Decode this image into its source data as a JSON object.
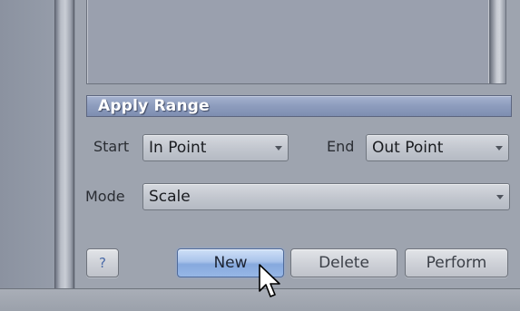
{
  "section": {
    "title": "Apply Range"
  },
  "range": {
    "start_label": "Start",
    "start_value": "In Point",
    "end_label": "End",
    "end_value": "Out Point"
  },
  "mode": {
    "label": "Mode",
    "value": "Scale"
  },
  "buttons": {
    "help": "?",
    "new": "New",
    "delete": "Delete",
    "perform": "Perform"
  },
  "colors": {
    "header_blue": "#8d9cbd",
    "primary_button": "#a9c3ea",
    "panel": "#9ea4af"
  },
  "icons": {
    "dropdown": "chevron-down-icon",
    "cursor": "mouse-pointer-icon"
  }
}
